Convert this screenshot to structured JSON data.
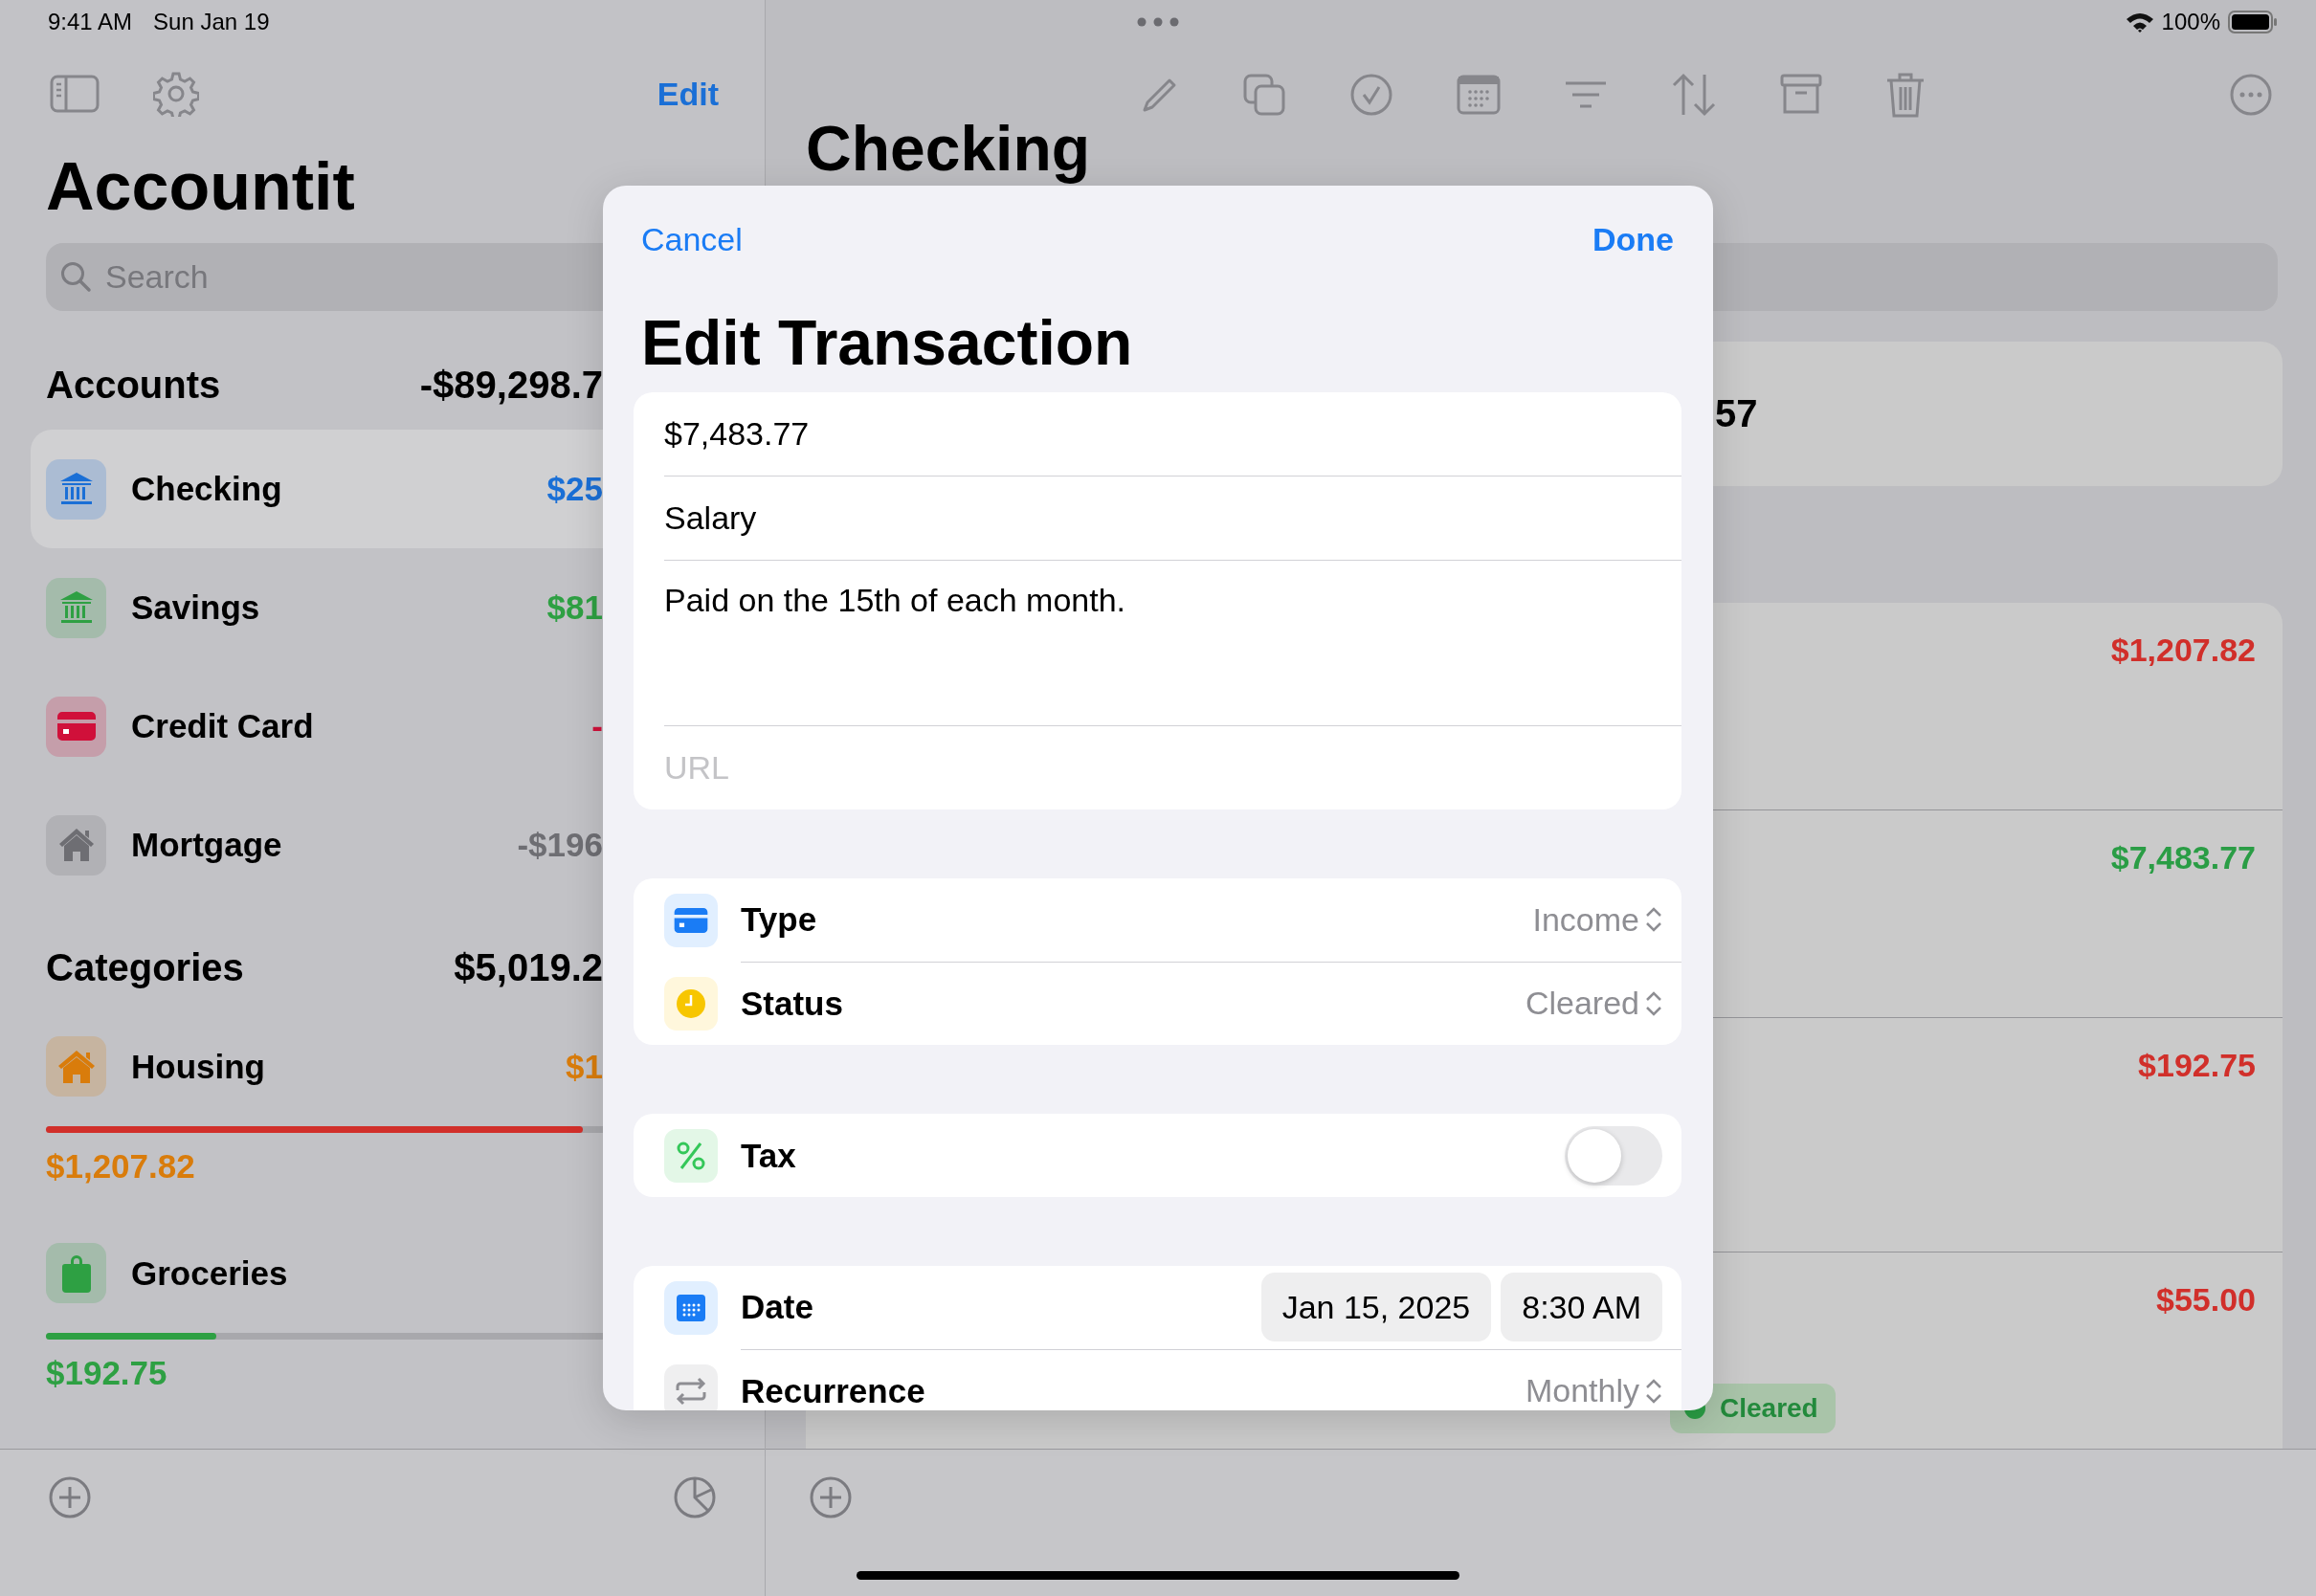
{
  "status_bar": {
    "time": "9:41 AM",
    "date": "Sun Jan 19",
    "battery": "100%"
  },
  "sidebar": {
    "edit": "Edit",
    "title": "Accountit",
    "search": {
      "placeholder": "Search"
    },
    "accounts": {
      "title": "Accounts",
      "total": "-$89,298.7",
      "items": [
        {
          "name": "Checking",
          "amount": "$25",
          "kind": "bank",
          "color": "#1a6fd6",
          "selected": true
        },
        {
          "name": "Savings",
          "amount": "$81",
          "kind": "bank",
          "color": "#2ea043",
          "selected": false
        },
        {
          "name": "Credit Card",
          "amount": "-",
          "kind": "card",
          "color": "#d0103a",
          "selected": false
        },
        {
          "name": "Mortgage",
          "amount": "-$196",
          "kind": "house",
          "color": "#6e6e73",
          "selected": false
        }
      ]
    },
    "categories": {
      "title": "Categories",
      "total": "$5,019.2",
      "items": [
        {
          "name": "Housing",
          "amount": "$1",
          "spent": "$1,207.82",
          "kind": "house",
          "color": "#d97c0b",
          "level": 0.79,
          "over_budget": true
        },
        {
          "name": "Groceries",
          "spent": "$192.75",
          "kind": "bag",
          "color": "#2ea043",
          "level": 0.25,
          "over_budget": false
        }
      ]
    }
  },
  "detail": {
    "title": "Checking",
    "balance": "57",
    "transactions": [
      {
        "amount": "$1,207.82",
        "kind": "expense"
      },
      {
        "amount": "$7,483.77",
        "kind": "income"
      },
      {
        "amount": "$192.75",
        "kind": "expense"
      },
      {
        "amount": "$55.00",
        "kind": "expense",
        "status": "Cleared"
      }
    ]
  },
  "sheet": {
    "cancel": "Cancel",
    "done": "Done",
    "title": "Edit Transaction",
    "amount": "$7,483.77",
    "payee": "Salary",
    "notes": "Paid on the 15th of each month.",
    "url": {
      "placeholder": "URL"
    },
    "type": {
      "label": "Type",
      "value": "Income"
    },
    "status": {
      "label": "Status",
      "value": "Cleared"
    },
    "tax": {
      "label": "Tax",
      "on": false
    },
    "date": {
      "label": "Date",
      "day": "Jan 15, 2025",
      "time": "8:30 AM"
    },
    "recurrence": {
      "label": "Recurrence",
      "value": "Monthly"
    }
  }
}
